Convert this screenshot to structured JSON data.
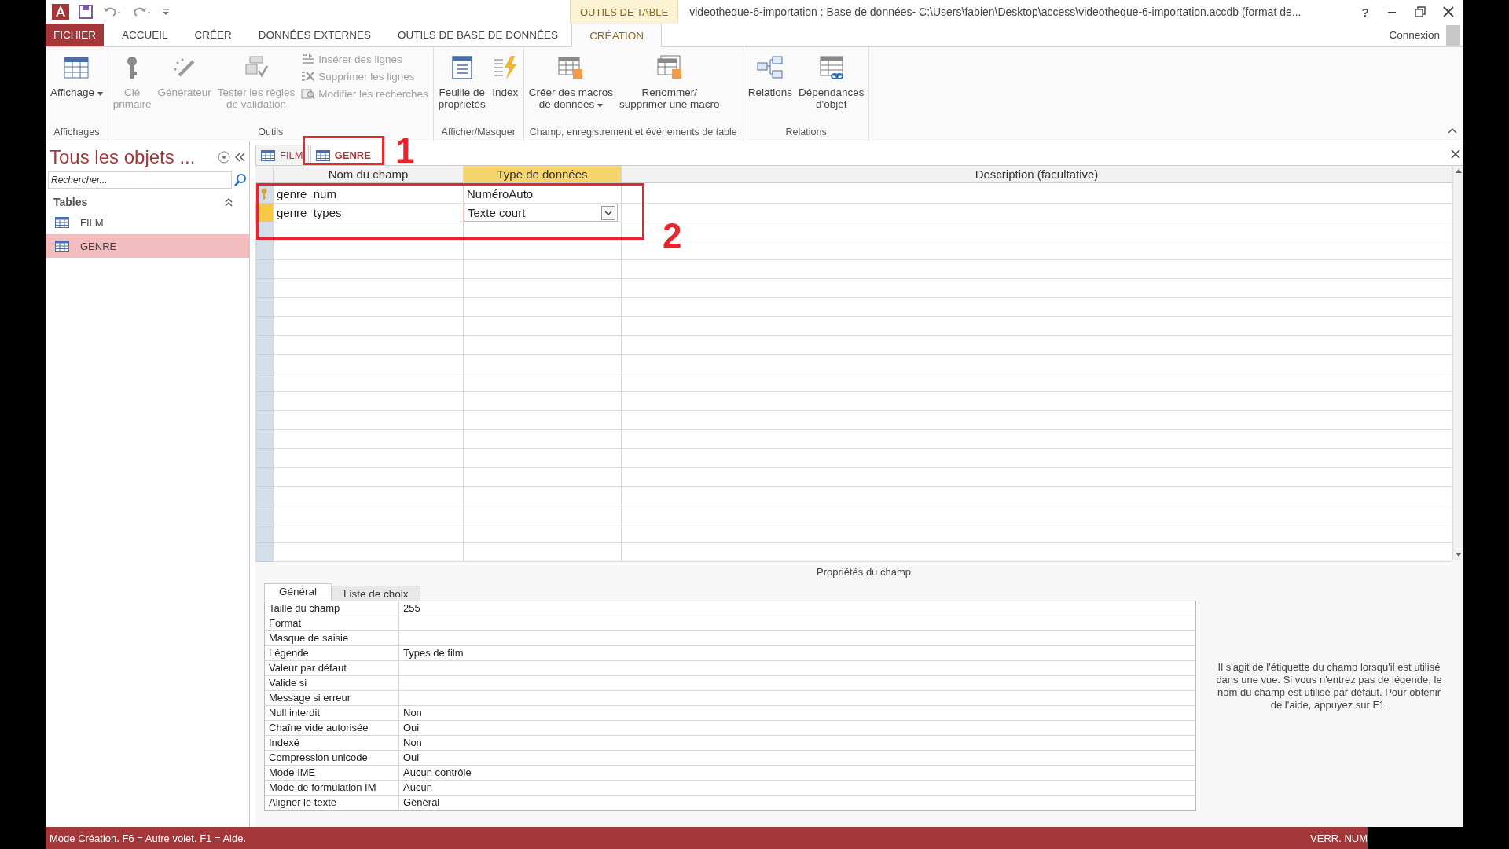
{
  "title_bar": {
    "contextual_label": "OUTILS DE TABLE",
    "title": "videotheque-6-importation : Base de données- C:\\Users\\fabien\\Desktop\\access\\videotheque-6-importation.accdb (format de...",
    "help": "?"
  },
  "ribbon_tabs": [
    {
      "label": "FICHIER",
      "kind": "file",
      "selected": false
    },
    {
      "label": "ACCUEIL",
      "kind": "normal",
      "selected": false
    },
    {
      "label": "CRÉER",
      "kind": "normal",
      "selected": false
    },
    {
      "label": "DONNÉES EXTERNES",
      "kind": "normal",
      "selected": false
    },
    {
      "label": "OUTILS DE BASE DE DONNÉES",
      "kind": "normal",
      "selected": false
    },
    {
      "label": "CRÉATION",
      "kind": "contextual",
      "selected": true
    }
  ],
  "account": {
    "label": "Connexion"
  },
  "ribbon_groups": [
    {
      "label": "Affichages",
      "buttons": [
        {
          "label": "Affichage",
          "kind": "large",
          "dropdown": true,
          "disabled": false
        }
      ]
    },
    {
      "label": "Outils",
      "buttons": [
        {
          "label": "Clé\nprimaire",
          "kind": "large",
          "dropdown": false,
          "disabled": true
        },
        {
          "label": "Générateur",
          "kind": "large",
          "dropdown": false,
          "disabled": true
        },
        {
          "label": "Tester les règles\nde validation",
          "kind": "large",
          "dropdown": false,
          "disabled": true
        },
        {
          "label": "Insérer des lignes",
          "kind": "small",
          "dropdown": false,
          "disabled": true
        },
        {
          "label": "Supprimer les lignes",
          "kind": "small",
          "dropdown": false,
          "disabled": true
        },
        {
          "label": "Modifier les recherches",
          "kind": "small",
          "dropdown": false,
          "disabled": true
        }
      ]
    },
    {
      "label": "Afficher/Masquer",
      "buttons": [
        {
          "label": "Feuille de\npropriétés",
          "kind": "large",
          "dropdown": false,
          "disabled": false
        },
        {
          "label": "Index",
          "kind": "large",
          "dropdown": false,
          "disabled": false
        }
      ]
    },
    {
      "label": "Champ, enregistrement et événements de table",
      "buttons": [
        {
          "label": "Créer des macros\nde données",
          "kind": "large",
          "dropdown": true,
          "disabled": false
        },
        {
          "label": "Renommer/\nsupprimer une macro",
          "kind": "large",
          "dropdown": false,
          "disabled": false
        }
      ]
    },
    {
      "label": "Relations",
      "buttons": [
        {
          "label": "Relations",
          "kind": "large",
          "dropdown": false,
          "disabled": false
        },
        {
          "label": "Dépendances\nd'objet",
          "kind": "large",
          "dropdown": false,
          "disabled": false
        }
      ]
    }
  ],
  "navigation": {
    "title": "Tous les objets ...",
    "search_placeholder": "Rechercher...",
    "groups": [
      {
        "label": "Tables",
        "items": [
          {
            "label": "FILM",
            "selected": false
          },
          {
            "label": "GENRE",
            "selected": true
          }
        ]
      }
    ]
  },
  "document_tabs": [
    {
      "label": "FILM",
      "selected": false
    },
    {
      "label": "GENRE",
      "selected": true
    }
  ],
  "design_grid": {
    "columns": [
      {
        "label": "Nom du champ",
        "selected": false
      },
      {
        "label": "Type de données",
        "selected": true
      },
      {
        "label": "Description (facultative)",
        "selected": false
      }
    ],
    "rows": [
      {
        "name": "genre_num",
        "type": "NuméroAuto",
        "primary_key": true,
        "current": false
      },
      {
        "name": "genre_types",
        "type": "Texte court",
        "primary_key": false,
        "current": true
      }
    ]
  },
  "annotations": [
    {
      "number": "1"
    },
    {
      "number": "2"
    }
  ],
  "field_properties": {
    "heading": "Propriétés du champ",
    "tabs": [
      {
        "label": "Général",
        "selected": true
      },
      {
        "label": "Liste de choix",
        "selected": false
      }
    ],
    "rows": [
      {
        "label": "Taille du champ",
        "value": "255"
      },
      {
        "label": "Format"
      },
      {
        "label": "Masque de saisie"
      },
      {
        "label": "Légende",
        "value": "Types de film"
      },
      {
        "label": "Valeur par défaut"
      },
      {
        "label": "Valide si"
      },
      {
        "label": "Message si erreur"
      },
      {
        "label": "Null interdit",
        "value": "Non"
      },
      {
        "label": "Chaîne vide autorisée",
        "value": "Oui"
      },
      {
        "label": "Indexé",
        "value": "Non"
      },
      {
        "label": "Compression unicode",
        "value": "Oui"
      },
      {
        "label": "Mode IME",
        "value": "Aucun contrôle"
      },
      {
        "label": "Mode de formulation IM",
        "value": "Aucun"
      },
      {
        "label": "Aligner le texte",
        "value": "Général"
      }
    ],
    "help": "Il s'agit de l'étiquette du champ lorsqu'il est utilisé dans une vue. Si vous n'entrez pas de légende, le nom du champ est utilisé par défaut. Pour obtenir de l'aide, appuyez sur F1."
  },
  "status_bar": {
    "message": "Mode Création. F6 = Autre volet. F1 = Aide.",
    "indicator": "VERR. NUM"
  }
}
